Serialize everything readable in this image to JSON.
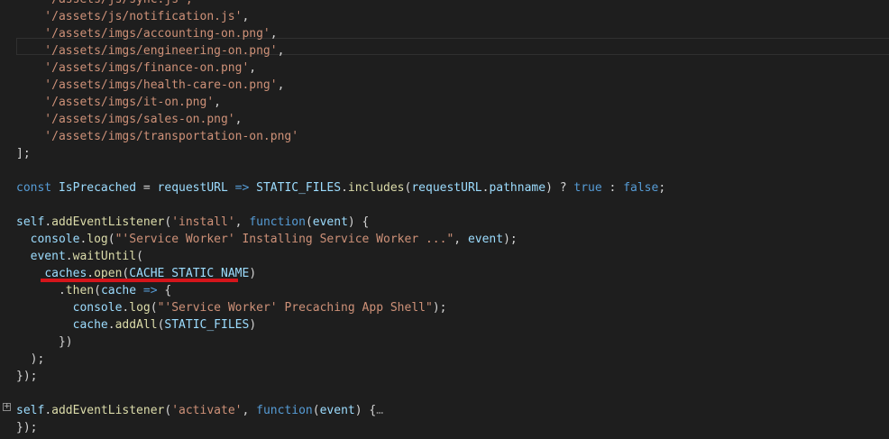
{
  "editor": {
    "lines": [
      {
        "cls": "partial",
        "tokens": [
          [
            "t-str",
            "    '/assets/js/syn"
          ],
          [
            "t-str",
            "c.js',"
          ]
        ]
      },
      {
        "tokens": [
          [
            "t-str",
            "    '/assets/js/notification.js'"
          ],
          [
            "t-p",
            ","
          ]
        ]
      },
      {
        "tokens": [
          [
            "t-str",
            "    '/assets/imgs/accounting-on.png'"
          ],
          [
            "t-p",
            ","
          ]
        ]
      },
      {
        "tokens": [
          [
            "t-str",
            "    '/assets/imgs/engineering-on.png'"
          ],
          [
            "t-p",
            ","
          ]
        ]
      },
      {
        "tokens": [
          [
            "t-str",
            "    '/assets/imgs/finance-on.png'"
          ],
          [
            "t-p",
            ","
          ]
        ]
      },
      {
        "tokens": [
          [
            "t-str",
            "    '/assets/imgs/health-care-on.png'"
          ],
          [
            "t-p",
            ","
          ]
        ]
      },
      {
        "tokens": [
          [
            "t-str",
            "    '/assets/imgs/it-on.png'"
          ],
          [
            "t-p",
            ","
          ]
        ]
      },
      {
        "tokens": [
          [
            "t-str",
            "    '/assets/imgs/sales-on.png'"
          ],
          [
            "t-p",
            ","
          ]
        ]
      },
      {
        "tokens": [
          [
            "t-str",
            "    '/assets/imgs/transportation-on.png'"
          ]
        ]
      },
      {
        "tokens": [
          [
            "t-p",
            "];"
          ]
        ]
      },
      {
        "tokens": []
      },
      {
        "tokens": [
          [
            "t-kw",
            "const"
          ],
          [
            "t-p",
            " "
          ],
          [
            "t-var",
            "IsPrecached"
          ],
          [
            "t-p",
            " = "
          ],
          [
            "t-var",
            "requestURL"
          ],
          [
            "t-p",
            " "
          ],
          [
            "t-kw",
            "=>"
          ],
          [
            "t-p",
            " "
          ],
          [
            "t-var",
            "STATIC_FILES"
          ],
          [
            "t-p",
            "."
          ],
          [
            "t-fn",
            "includes"
          ],
          [
            "t-p",
            "("
          ],
          [
            "t-var",
            "requestURL"
          ],
          [
            "t-p",
            "."
          ],
          [
            "t-var",
            "pathname"
          ],
          [
            "t-p",
            ") ? "
          ],
          [
            "t-kw",
            "true"
          ],
          [
            "t-p",
            " : "
          ],
          [
            "t-kw",
            "false"
          ],
          [
            "t-p",
            ";"
          ]
        ]
      },
      {
        "tokens": []
      },
      {
        "tokens": [
          [
            "t-var",
            "self"
          ],
          [
            "t-p",
            "."
          ],
          [
            "t-fn",
            "addEventListener"
          ],
          [
            "t-p",
            "("
          ],
          [
            "t-str",
            "'install'"
          ],
          [
            "t-p",
            ", "
          ],
          [
            "t-kw",
            "function"
          ],
          [
            "t-p",
            "("
          ],
          [
            "t-var",
            "event"
          ],
          [
            "t-p",
            ") {"
          ]
        ]
      },
      {
        "tokens": [
          [
            "t-p",
            "  "
          ],
          [
            "t-var",
            "console"
          ],
          [
            "t-p",
            "."
          ],
          [
            "t-fn",
            "log"
          ],
          [
            "t-p",
            "("
          ],
          [
            "t-str",
            "\"'Service Worker' Installing Service Worker ...\""
          ],
          [
            "t-p",
            ", "
          ],
          [
            "t-var",
            "event"
          ],
          [
            "t-p",
            ");"
          ]
        ]
      },
      {
        "tokens": [
          [
            "t-p",
            "  "
          ],
          [
            "t-var",
            "event"
          ],
          [
            "t-p",
            "."
          ],
          [
            "t-fn",
            "waitUntil"
          ],
          [
            "t-p",
            "("
          ]
        ]
      },
      {
        "tokens": [
          [
            "t-p",
            "    "
          ],
          [
            "t-var",
            "caches"
          ],
          [
            "t-p",
            "."
          ],
          [
            "t-fn",
            "open"
          ],
          [
            "t-p",
            "("
          ],
          [
            "t-var",
            "CACHE_STATIC_NAME"
          ],
          [
            "t-p",
            ")"
          ]
        ]
      },
      {
        "tokens": [
          [
            "t-p",
            "      ."
          ],
          [
            "t-fn",
            "then"
          ],
          [
            "t-p",
            "("
          ],
          [
            "t-var",
            "cache"
          ],
          [
            "t-p",
            " "
          ],
          [
            "t-kw",
            "=>"
          ],
          [
            "t-p",
            " {"
          ]
        ]
      },
      {
        "tokens": [
          [
            "t-p",
            "        "
          ],
          [
            "t-var",
            "console"
          ],
          [
            "t-p",
            "."
          ],
          [
            "t-fn",
            "log"
          ],
          [
            "t-p",
            "("
          ],
          [
            "t-str",
            "\"'Service Worker' Precaching App Shell\""
          ],
          [
            "t-p",
            ");"
          ]
        ]
      },
      {
        "tokens": [
          [
            "t-p",
            "        "
          ],
          [
            "t-var",
            "cache"
          ],
          [
            "t-p",
            "."
          ],
          [
            "t-fn",
            "addAll"
          ],
          [
            "t-p",
            "("
          ],
          [
            "t-var",
            "STATIC_FILES"
          ],
          [
            "t-p",
            ")"
          ]
        ]
      },
      {
        "tokens": [
          [
            "t-p",
            "      })"
          ]
        ]
      },
      {
        "tokens": [
          [
            "t-p",
            "  );"
          ]
        ]
      },
      {
        "tokens": [
          [
            "t-p",
            "});"
          ]
        ]
      },
      {
        "tokens": []
      },
      {
        "fold": true,
        "tokens": [
          [
            "t-var",
            "self"
          ],
          [
            "t-p",
            "."
          ],
          [
            "t-fn",
            "addEventListener"
          ],
          [
            "t-p",
            "("
          ],
          [
            "t-str",
            "'activate'"
          ],
          [
            "t-p",
            ", "
          ],
          [
            "t-kw",
            "function"
          ],
          [
            "t-p",
            "("
          ],
          [
            "t-var",
            "event"
          ],
          [
            "t-p",
            ") {"
          ],
          [
            "t-fold",
            "…"
          ]
        ]
      },
      {
        "tokens": [
          [
            "t-p",
            "});"
          ]
        ]
      }
    ],
    "fold_glyph": "+"
  }
}
